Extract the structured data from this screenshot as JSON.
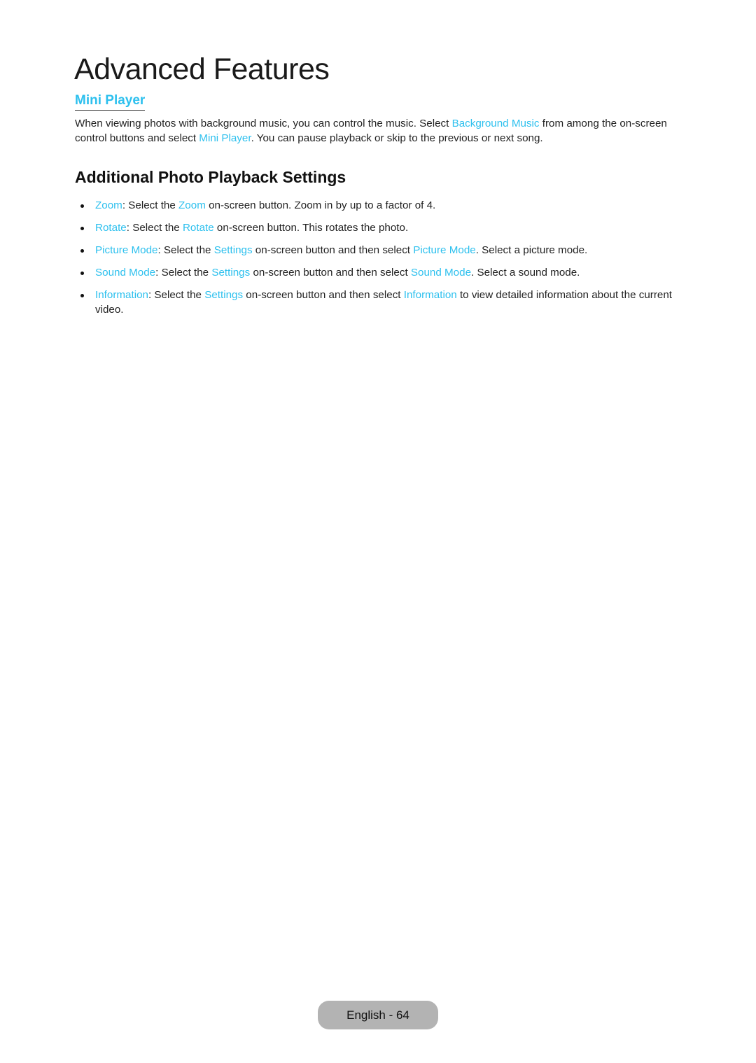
{
  "page": {
    "title": "Advanced Features",
    "accent_color": "#2dc0ee"
  },
  "mini_player": {
    "heading": "Mini Player",
    "paragraph": [
      {
        "text": "When viewing photos with background music, you can control the music. Select ",
        "highlight": false
      },
      {
        "text": "Background Music",
        "highlight": true
      },
      {
        "text": " from among the on-screen control buttons and select ",
        "highlight": false
      },
      {
        "text": "Mini Player",
        "highlight": true
      },
      {
        "text": ". You can pause playback or skip to the previous or next song.",
        "highlight": false
      }
    ]
  },
  "additional_settings": {
    "heading": "Additional Photo Playback Settings",
    "items": [
      [
        {
          "text": "Zoom",
          "highlight": true
        },
        {
          "text": ": Select the ",
          "highlight": false
        },
        {
          "text": "Zoom",
          "highlight": true
        },
        {
          "text": " on-screen button. Zoom in by up to a factor of 4.",
          "highlight": false
        }
      ],
      [
        {
          "text": "Rotate",
          "highlight": true
        },
        {
          "text": ": Select the ",
          "highlight": false
        },
        {
          "text": "Rotate",
          "highlight": true
        },
        {
          "text": " on-screen button. This rotates the photo.",
          "highlight": false
        }
      ],
      [
        {
          "text": "Picture Mode",
          "highlight": true
        },
        {
          "text": ": Select the ",
          "highlight": false
        },
        {
          "text": "Settings",
          "highlight": true
        },
        {
          "text": " on-screen button and then select ",
          "highlight": false
        },
        {
          "text": "Picture Mode",
          "highlight": true
        },
        {
          "text": ". Select a picture mode.",
          "highlight": false
        }
      ],
      [
        {
          "text": "Sound Mode",
          "highlight": true
        },
        {
          "text": ": Select the ",
          "highlight": false
        },
        {
          "text": "Settings",
          "highlight": true
        },
        {
          "text": " on-screen button and then select ",
          "highlight": false
        },
        {
          "text": "Sound Mode",
          "highlight": true
        },
        {
          "text": ". Select a sound mode.",
          "highlight": false
        }
      ],
      [
        {
          "text": "Information",
          "highlight": true
        },
        {
          "text": ": Select the ",
          "highlight": false
        },
        {
          "text": "Settings",
          "highlight": true
        },
        {
          "text": " on-screen button and then select ",
          "highlight": false
        },
        {
          "text": "Information",
          "highlight": true
        },
        {
          "text": " to view detailed information about the current video.",
          "highlight": false
        }
      ]
    ]
  },
  "footer": {
    "label": "English - 64"
  }
}
